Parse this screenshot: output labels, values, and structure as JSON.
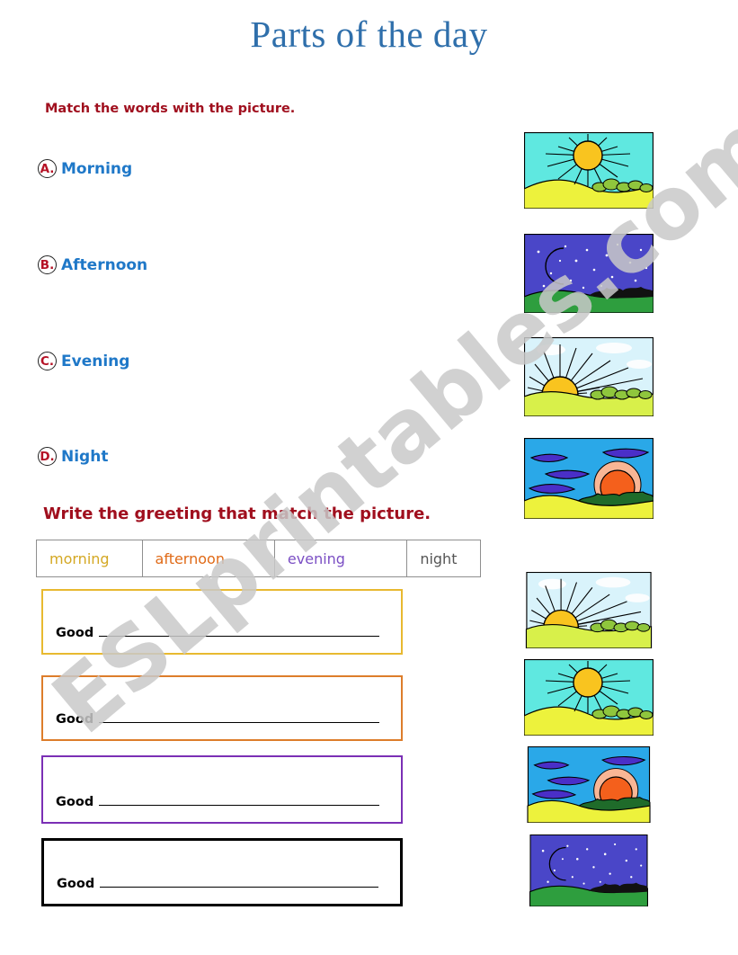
{
  "title": "Parts of the day",
  "instructions": {
    "match": "Match the words with the picture.",
    "write": "Write the greeting that match the picture."
  },
  "match_items": [
    {
      "letter": "A.",
      "word": "Morning"
    },
    {
      "letter": "B.",
      "word": "Afternoon"
    },
    {
      "letter": "C.",
      "word": "Evening"
    },
    {
      "letter": "D.",
      "word": "Night"
    }
  ],
  "word_bank": [
    {
      "word": "morning",
      "color": "#d4a823"
    },
    {
      "word": "afternoon",
      "color": "#e06a17"
    },
    {
      "word": "evening",
      "color": "#7b4fc4"
    },
    {
      "word": "night",
      "color": "#555555"
    }
  ],
  "answer_boxes": [
    {
      "prompt": "Good",
      "border_color": "#e8b930"
    },
    {
      "prompt": "Good",
      "border_color": "#dd7d2b"
    },
    {
      "prompt": "Good",
      "border_color": "#7b2fb5"
    },
    {
      "prompt": "Good",
      "border_color": "#000000"
    }
  ],
  "pictures_match_column": [
    {
      "scene": "midday-sun-picture"
    },
    {
      "scene": "night-moon-picture"
    },
    {
      "scene": "sunrise-picture"
    },
    {
      "scene": "sunset-picture"
    }
  ],
  "pictures_write_column": [
    {
      "scene": "sunrise-picture"
    },
    {
      "scene": "midday-sun-picture"
    },
    {
      "scene": "sunset-picture"
    },
    {
      "scene": "night-moon-picture"
    }
  ],
  "watermark": {
    "text": "ESLprintables.com",
    "color": "#c9c9c9"
  },
  "colors": {
    "title": "#2f6fab",
    "instruction": "#a00f1e",
    "match_word": "#1f78c8",
    "match_letter": "#b51226",
    "table_border": "#8f8f8f"
  }
}
